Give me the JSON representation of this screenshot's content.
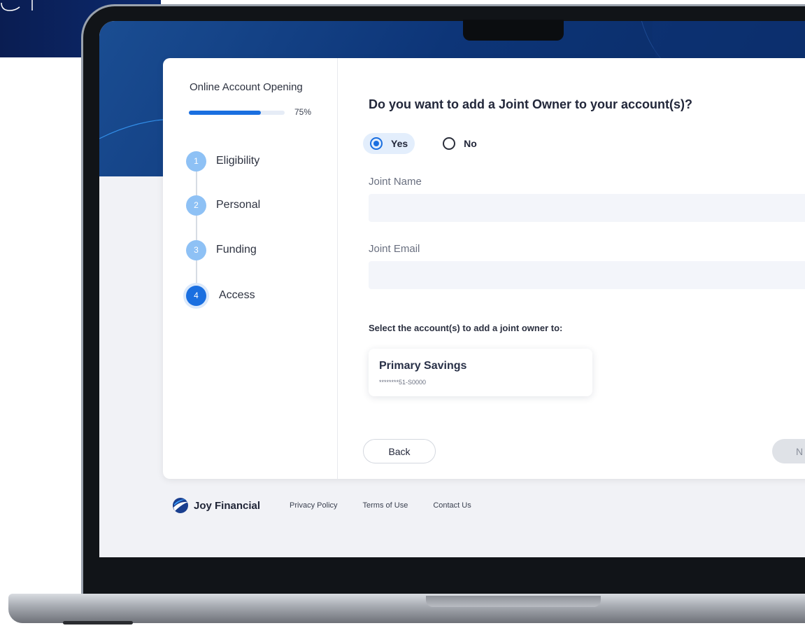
{
  "sidebar": {
    "title": "Online Account Opening",
    "progress_percent": 75,
    "progress_label": "75%",
    "steps": [
      {
        "number": "1",
        "label": "Eligibility"
      },
      {
        "number": "2",
        "label": "Personal"
      },
      {
        "number": "3",
        "label": "Funding"
      },
      {
        "number": "4",
        "label": "Access"
      }
    ]
  },
  "form": {
    "question": "Do you want to add a Joint Owner to your account(s)?",
    "options": [
      {
        "label": "Yes",
        "selected": true
      },
      {
        "label": "No",
        "selected": false
      }
    ],
    "joint_name_label": "Joint Name",
    "joint_name_value": "",
    "joint_email_label": "Joint Email",
    "joint_email_value": "",
    "select_label": "Select the account(s) to add a joint owner to:",
    "account": {
      "name": "Primary Savings",
      "number": "********51-S0000"
    }
  },
  "buttons": {
    "back": "Back",
    "next": "N"
  },
  "footer": {
    "brand": "Joy Financial",
    "links": [
      "Privacy Policy",
      "Terms of Use",
      "Contact Us"
    ]
  },
  "colors": {
    "accent": "#1a6fe0",
    "step_inactive": "#8ec1f5",
    "hero": "#0d3578"
  },
  "icons": [
    "radio-selected-icon",
    "radio-unselected-icon",
    "joy-financial-logo-icon"
  ]
}
